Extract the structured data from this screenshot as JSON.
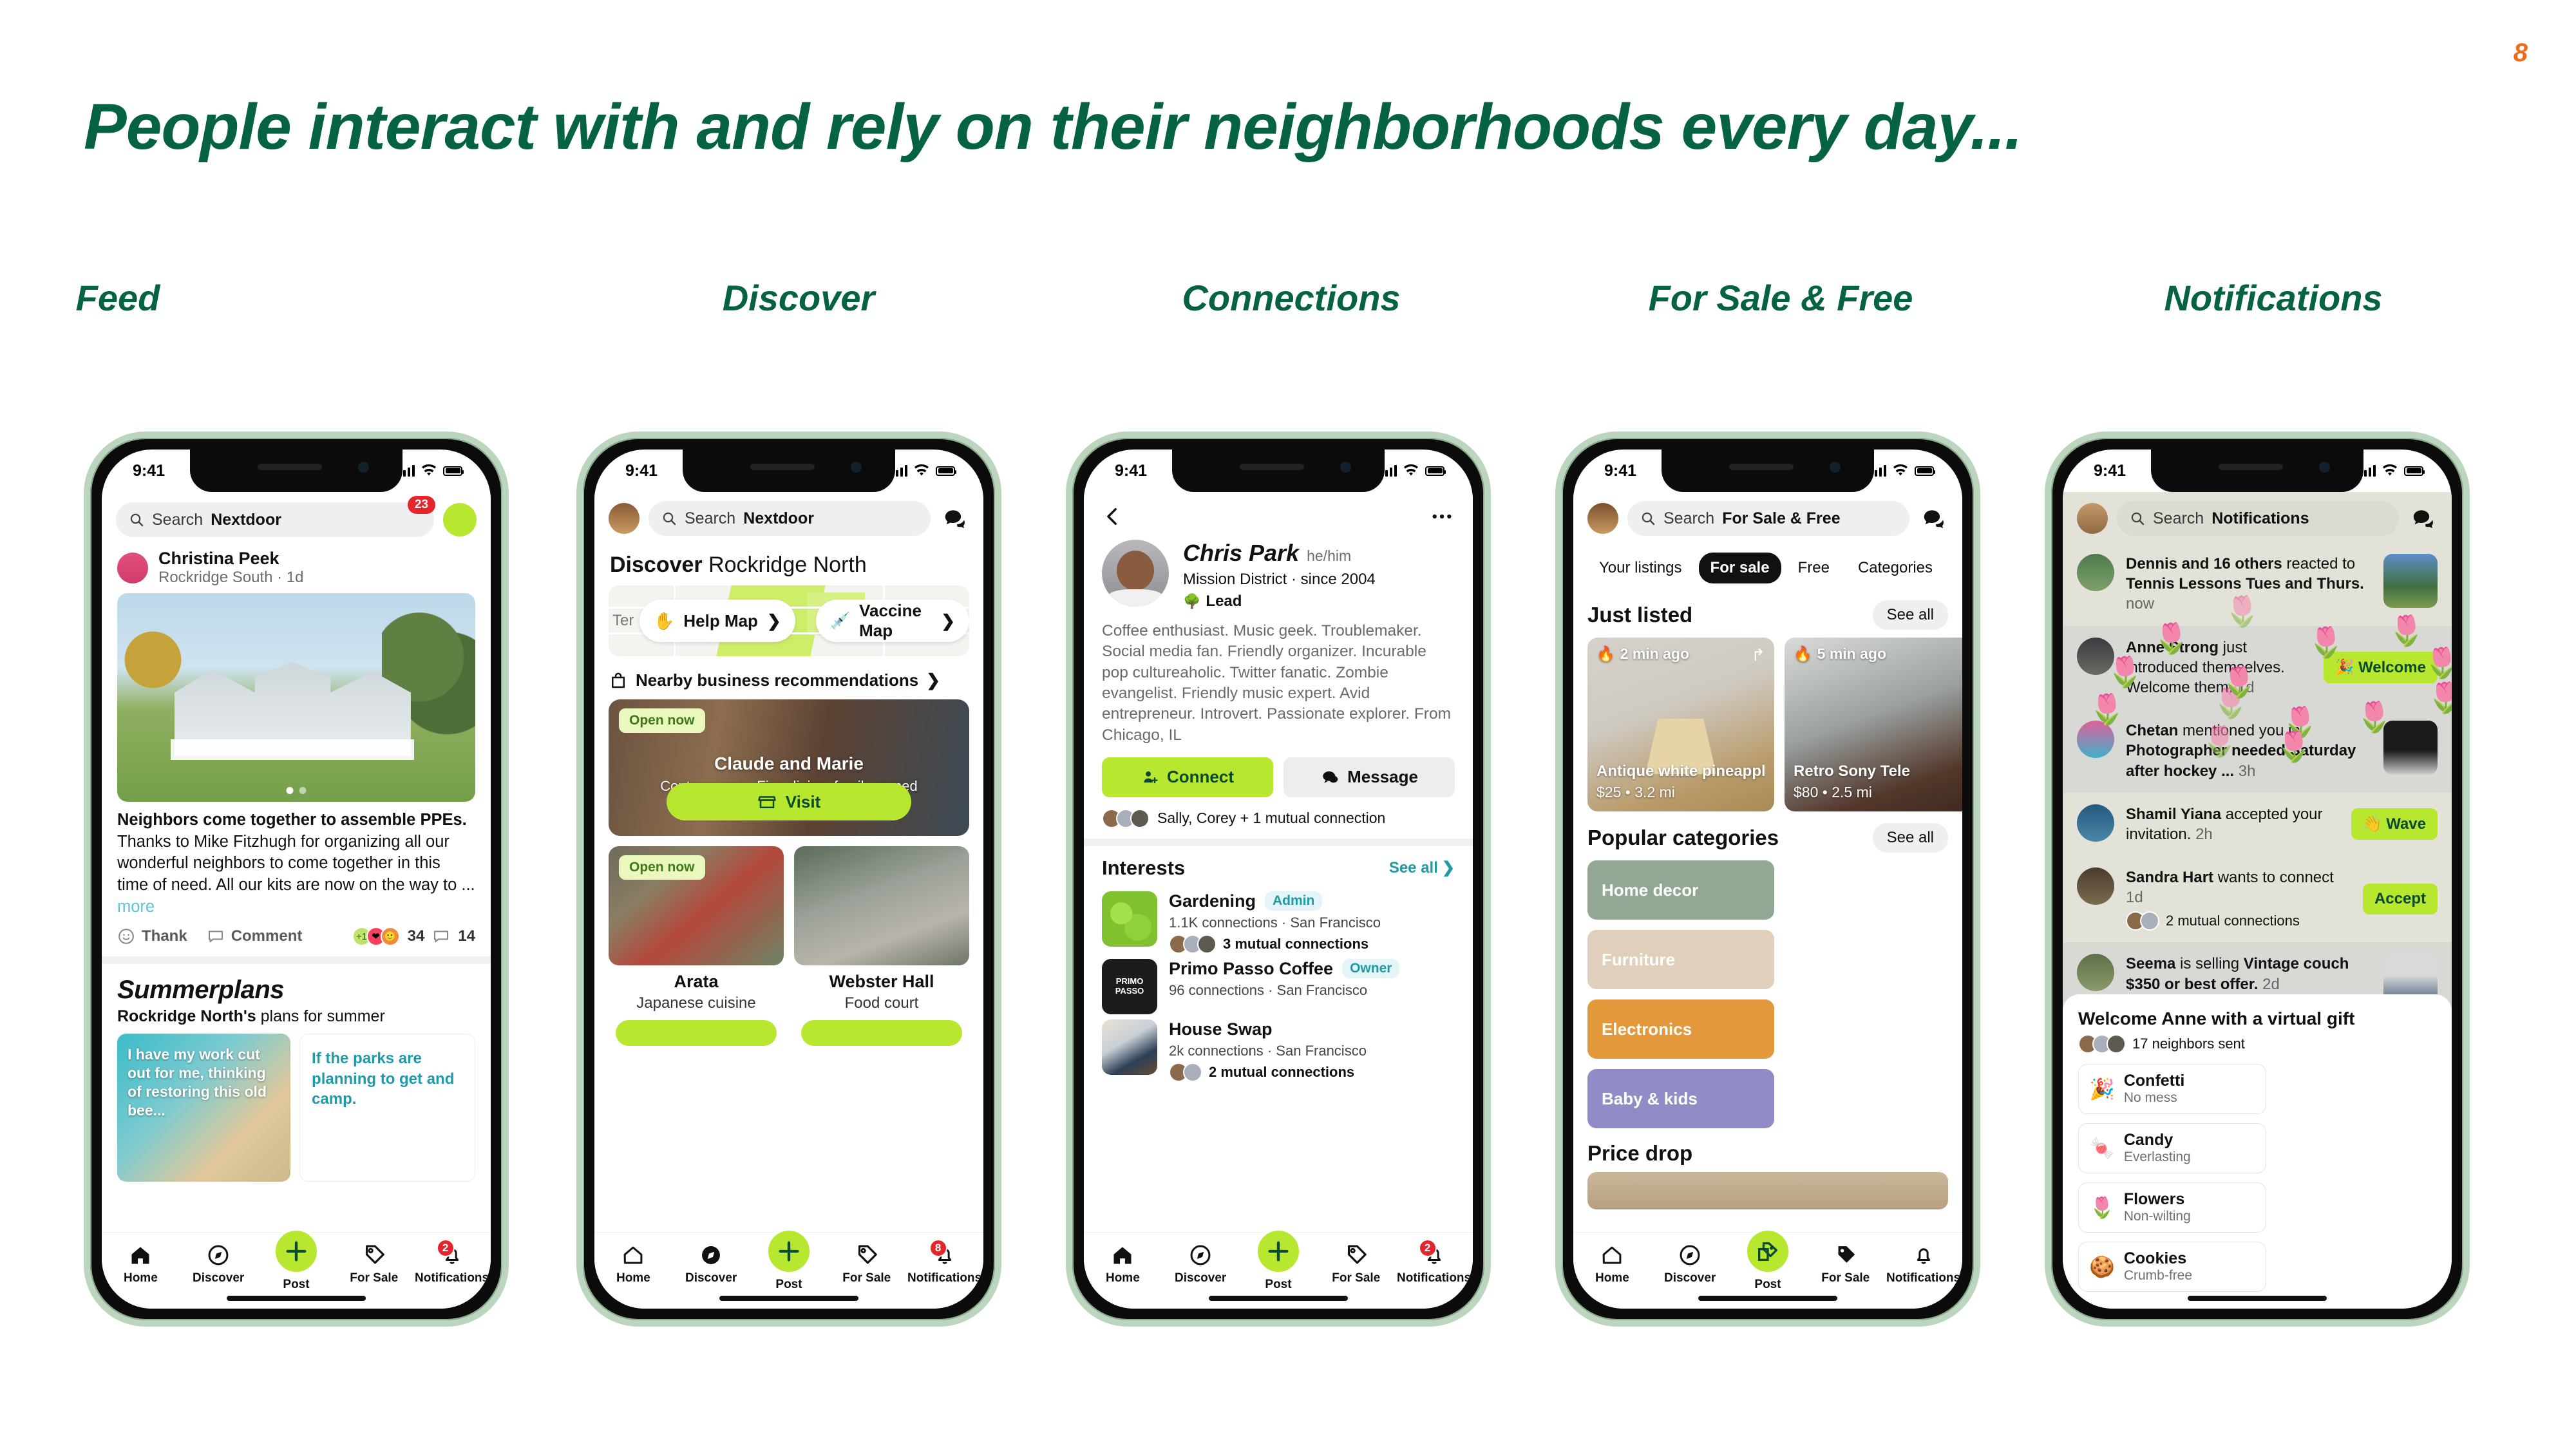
{
  "slide": {
    "page_number": "8",
    "headline": "People interact with and rely on their neighborhoods every day...",
    "accent_green": "#056343",
    "brand_lime": "#b8e730",
    "page_number_color": "#ef6c1a"
  },
  "columns": [
    {
      "label": "Feed"
    },
    {
      "label": "Discover"
    },
    {
      "label": "Connections"
    },
    {
      "label": "For Sale & Free"
    },
    {
      "label": "Notifications"
    }
  ],
  "status_bar": {
    "time": "9:41"
  },
  "tabbar": {
    "items": [
      {
        "label": "Home",
        "icon": "home-icon"
      },
      {
        "label": "Discover",
        "icon": "compass-icon"
      },
      {
        "label": "Post",
        "icon": "plus-icon"
      },
      {
        "label": "For Sale",
        "icon": "price-tag-icon"
      },
      {
        "label": "Notifications",
        "icon": "bell-icon"
      }
    ],
    "badge_feed": "2",
    "badge_discover": "8",
    "badge_connections": "2"
  },
  "feed": {
    "search_placeholder_prefix": "Search ",
    "search_placeholder_brand": "Nextdoor",
    "unread_badge": "23",
    "post": {
      "author": "Christina Peek",
      "meta": "Rockridge South · 1d",
      "title": "Neighbors come together to assemble PPEs.",
      "body": "Thanks to Mike Fitzhugh for organizing all our wonderful neighbors to come together in this time of need. All our kits are now on the way to ... ",
      "more_label": "more",
      "thank_label": "Thank",
      "comment_label": "Comment",
      "reaction_count": "34",
      "comment_count": "14"
    },
    "summerplans": {
      "title": "Summerplans",
      "subtitle_bold": "Rockridge North's",
      "subtitle_rest": " plans for summer",
      "card1_quote": "I have my work cut out for me, thinking of restoring this old bee...",
      "card2_quote": "If the parks are planning to get and camp."
    }
  },
  "discover": {
    "search_placeholder_prefix": "Search ",
    "search_placeholder_brand": "Nextdoor",
    "title_bold": "Discover",
    "title_rest": " Rockridge North",
    "map_edge_text": "Ter",
    "map_pill_help": "Help Map",
    "map_pill_vaccine": "Vaccine Map",
    "nearby_label": "Nearby business recommendations",
    "hero": {
      "open_now": "Open now",
      "name": "Claude and Marie",
      "desc": "Contemporary, Fine dining, family-owned",
      "visit_label": "Visit"
    },
    "cards": [
      {
        "open_now": "Open now",
        "name": "Arata",
        "sub": "Japanese cuisine"
      },
      {
        "open_now": "",
        "name": "Webster Hall",
        "sub": "Food court"
      }
    ]
  },
  "connections": {
    "name": "Chris Park",
    "pronouns": "he/him",
    "meta": "Mission District ·  since 2004",
    "lead_label": "Lead",
    "bio": "Coffee enthusiast. Music geek. Troublemaker. Social media fan. Friendly organizer. Incurable pop cultureaholic. Twitter fanatic. Zombie evangelist. Friendly music expert. Avid entrepreneur. Introvert. Passionate explorer. From Chicago, IL",
    "connect_label": "Connect",
    "message_label": "Message",
    "mutual_label": "Sally, Corey + 1 mutual connection",
    "interests_title": "Interests",
    "see_all": "See all",
    "interests": [
      {
        "name": "Gardening",
        "badge": "Admin",
        "sub": "1.1K connections  ·  San Francisco",
        "mutual": "3 mutual connections"
      },
      {
        "name": "Primo Passo Coffee",
        "badge": "Owner",
        "sub": "96 connections  ·  San Francisco",
        "mutual": ""
      },
      {
        "name": "House Swap",
        "badge": "",
        "sub": "2k connections  ·  San Francisco",
        "mutual": "2 mutual connections"
      }
    ]
  },
  "forsale": {
    "search_placeholder_prefix": "Search ",
    "search_placeholder_brand": "For Sale & Free",
    "tabs": [
      "Your listings",
      "For sale",
      "Free",
      "Categories"
    ],
    "active_tab": "For sale",
    "just_listed_title": "Just listed",
    "see_all": "See all",
    "listings": [
      {
        "time": "2 min ago",
        "title": "Antique white pineapple l...",
        "price": "$25 • 3.2 mi"
      },
      {
        "time": "5 min ago",
        "title": "Retro Sony Tele",
        "price": "$80 • 2.5 mi"
      }
    ],
    "categories_title": "Popular categories",
    "categories": [
      {
        "label": "Home decor",
        "color": "#93a894"
      },
      {
        "label": "Furniture",
        "color": "#e0cfbb"
      },
      {
        "label": "Electronics",
        "color": "#e3983b"
      },
      {
        "label": "Baby & kids",
        "color": "#8f8cc6"
      }
    ],
    "price_drop_title": "Price drop"
  },
  "notifications": {
    "search_placeholder_prefix": "Search ",
    "search_placeholder_brand": "Notifications",
    "items": [
      {
        "bold": "Dennis and 16 others",
        "rest": " reacted to ",
        "bold2": "Tennis Lessons Tues and Thurs.",
        "time": " now",
        "action": "",
        "thumb": "tennis"
      },
      {
        "bold": "Anne Strong",
        "rest": " just introduced themselves. Welcome them. ",
        "bold2": "",
        "time": "1d",
        "action": "🎉 Welcome",
        "thumb": ""
      },
      {
        "bold": "Chetan",
        "rest": " mentioned you in ",
        "bold2": "Photographer needed Saturday after hockey ...",
        "time": " 3h",
        "action": "",
        "thumb": "studio"
      },
      {
        "bold": "Shamil Yiana",
        "rest": " accepted your invitation. ",
        "bold2": "",
        "time": "2h",
        "action": "👋 Wave",
        "thumb": ""
      },
      {
        "bold": "Sandra Hart",
        "rest": " wants to connect ",
        "bold2": "",
        "time": "1d",
        "action": "Accept",
        "mutual": "2 mutual connections",
        "thumb": ""
      },
      {
        "bold": "Seema",
        "rest": " is selling ",
        "bold2": "Vintage couch $350 or best offer.",
        "time": " 2d",
        "action": "",
        "thumb": "couch"
      }
    ],
    "gift_sheet": {
      "title": "Welcome Anne with a virtual gift",
      "subtitle": "17 neighbors sent",
      "options": [
        {
          "icon": "🎉",
          "name": "Confetti",
          "desc": "No mess"
        },
        {
          "icon": "🍬",
          "name": "Candy",
          "desc": "Everlasting"
        },
        {
          "icon": "🌷",
          "name": "Flowers",
          "desc": "Non-wilting"
        },
        {
          "icon": "🍪",
          "name": "Cookies",
          "desc": "Crumb-free"
        }
      ]
    }
  }
}
